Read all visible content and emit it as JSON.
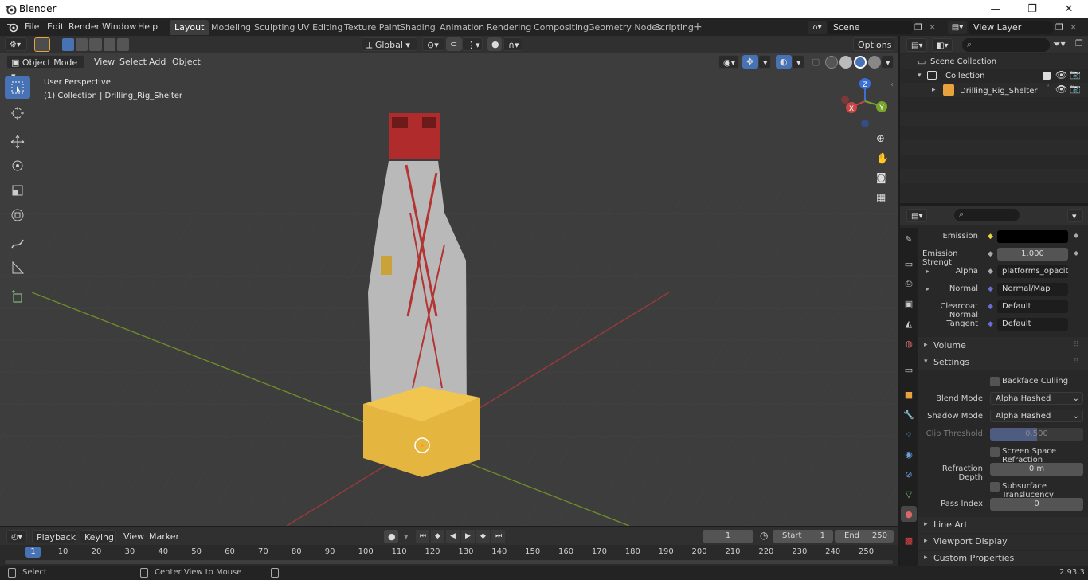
{
  "window": {
    "title": "Blender",
    "minimize": "—",
    "restore": "❐",
    "close": "✕"
  },
  "menu": [
    "File",
    "Edit",
    "Render",
    "Window",
    "Help"
  ],
  "workspaces": [
    "Layout",
    "Modeling",
    "Sculpting",
    "UV Editing",
    "Texture Paint",
    "Shading",
    "Animation",
    "Rendering",
    "Compositing",
    "Geometry Nodes",
    "Scripting"
  ],
  "scene": {
    "name": "Scene",
    "view_layer": "View Layer"
  },
  "viewport": {
    "mode": "Object Mode",
    "menus": [
      "View",
      "Select",
      "Add",
      "Object"
    ],
    "transform_orientation": "Global",
    "options_label": "Options",
    "overlay_title": "User Perspective",
    "overlay_subtitle": "(1) Collection | Drilling_Rig_Shelter",
    "gizmo_axes": {
      "x": "X",
      "y": "Y",
      "z": "Z"
    }
  },
  "outliner": {
    "root": "Scene Collection",
    "collection": "Collection",
    "object": "Drilling_Rig_Shelter"
  },
  "properties": {
    "rows": [
      {
        "label": "Emission",
        "value": ""
      },
      {
        "label": "Emission Strengt",
        "value": "1.000"
      },
      {
        "label": "Alpha",
        "value": "platforms_opacity.pn"
      },
      {
        "label": "Normal",
        "value": "Normal/Map"
      },
      {
        "label": "Clearcoat Normal",
        "value": "Default"
      },
      {
        "label": "Tangent",
        "value": "Default"
      }
    ],
    "volume": "Volume",
    "settings": "Settings",
    "backface_culling": "Backface Culling",
    "blend_mode_label": "Blend Mode",
    "blend_mode": "Alpha Hashed",
    "shadow_mode_label": "Shadow Mode",
    "shadow_mode": "Alpha Hashed",
    "clip_threshold_label": "Clip Threshold",
    "clip_threshold": "0.500",
    "ssr": "Screen Space Refraction",
    "refraction_depth_label": "Refraction Depth",
    "refraction_depth": "0 m",
    "sss": "Subsurface Translucency",
    "pass_index_label": "Pass Index",
    "pass_index": "0",
    "line_art": "Line Art",
    "viewport_display": "Viewport Display",
    "custom_properties": "Custom Properties"
  },
  "timeline": {
    "playback": "Playback",
    "keying": "Keying",
    "view": "View",
    "marker": "Marker",
    "current_frame": "1",
    "start_label": "Start",
    "start": "1",
    "end_label": "End",
    "end": "250",
    "ticks": [
      "10",
      "20",
      "30",
      "40",
      "50",
      "60",
      "70",
      "80",
      "90",
      "100",
      "110",
      "120",
      "130",
      "140",
      "150",
      "160",
      "170",
      "180",
      "190",
      "200",
      "210",
      "220",
      "230",
      "240",
      "250"
    ],
    "playhead": "1"
  },
  "status": {
    "select": "Select",
    "center": "Center View to Mouse",
    "version": "2.93.3"
  },
  "colors": {
    "accent": "#4772b3",
    "active_tab": "#3d3d3d",
    "object_orange": "#e8a33d"
  }
}
